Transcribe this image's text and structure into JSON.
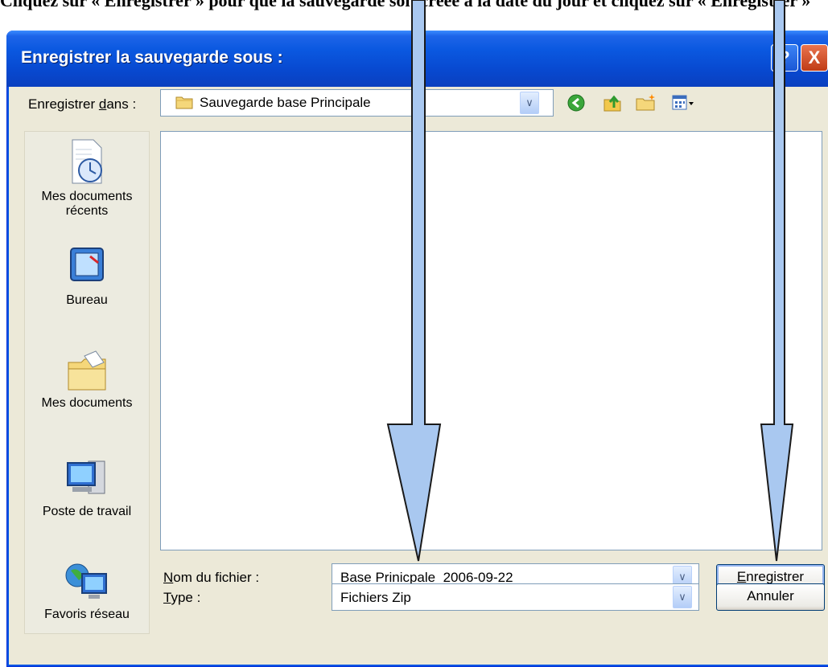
{
  "top_text": "Cliquez sur « Enregistrer » pour que la sauvegarde soit créée à la date du jour et cliquez sur « Enregistrer »",
  "dialog": {
    "title": "Enregistrer la sauvegarde sous :",
    "help_label": "?",
    "close_label": "X"
  },
  "toolbar": {
    "save_in_label_pre": "Enregistrer ",
    "save_in_label_u": "d",
    "save_in_label_post": "ans :",
    "save_in_value": "Sauvegarde base Principale",
    "icons": [
      "back-icon",
      "up-folder-icon",
      "new-folder-icon",
      "views-menu-icon"
    ]
  },
  "places": [
    {
      "label": "Mes documents récents",
      "line1": "Mes documents",
      "line2": "récents",
      "icon": "recent-documents-icon"
    },
    {
      "label": "Bureau",
      "line1": "Bureau",
      "line2": "",
      "icon": "desktop-icon"
    },
    {
      "label": "Mes documents",
      "line1": "Mes documents",
      "line2": "",
      "icon": "my-documents-icon"
    },
    {
      "label": "Poste de travail",
      "line1": "Poste de travail",
      "line2": "",
      "icon": "my-computer-icon"
    },
    {
      "label": "Favoris réseau",
      "line1": "Favoris réseau",
      "line2": "",
      "icon": "network-places-icon"
    }
  ],
  "fields": {
    "filename_label_u": "N",
    "filename_label_rest": "om du fichier :",
    "filename_value": "Base Prinicpale_2006-09-22",
    "type_label_u": "T",
    "type_label_rest": "ype :",
    "type_value": "Fichiers Zip"
  },
  "buttons": {
    "save_u": "E",
    "save_rest": "nregistrer",
    "cancel": "Annuler"
  },
  "colors": {
    "titlebar": "#0a58e0",
    "dialog_bg": "#ece9d8",
    "arrow_fill": "#a9c8f0",
    "arrow_stroke": "#1a1a1a"
  }
}
